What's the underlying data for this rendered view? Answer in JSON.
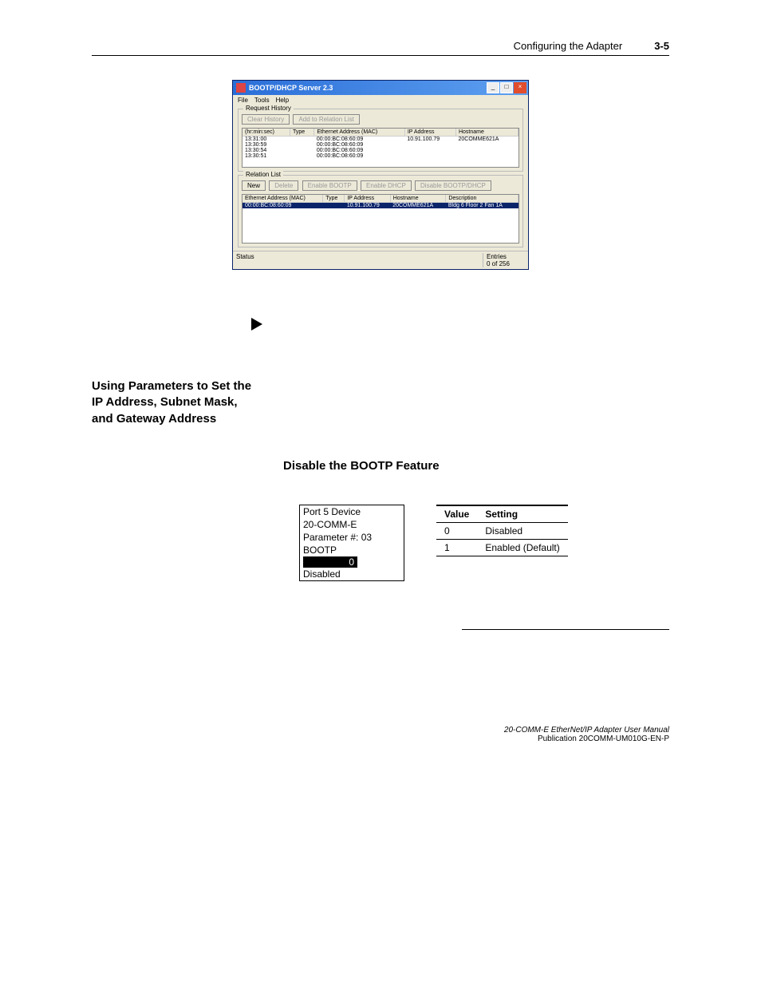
{
  "header": {
    "title": "Configuring the Adapter",
    "page": "3-5"
  },
  "win": {
    "title": "BOOTP/DHCP Server 2.3",
    "menu": [
      "File",
      "Tools",
      "Help"
    ],
    "request_history": {
      "label": "Request History",
      "buttons": {
        "clear": "Clear History",
        "add": "Add to Relation List"
      },
      "columns": [
        "(hr:min:sec)",
        "Type",
        "Ethernet Address (MAC)",
        "IP Address",
        "Hostname"
      ],
      "rows": [
        {
          "time": "13:31:00",
          "type": "",
          "mac": "00:00:BC:08:60:09",
          "ip": "10.91.100.79",
          "host": "20COMME621A"
        },
        {
          "time": "13:30:59",
          "type": "",
          "mac": "00:00:BC:08:60:09",
          "ip": "",
          "host": ""
        },
        {
          "time": "13:30:54",
          "type": "",
          "mac": "00:00:BC:08:60:09",
          "ip": "",
          "host": ""
        },
        {
          "time": "13:30:51",
          "type": "",
          "mac": "00:00:BC:08:60:09",
          "ip": "",
          "host": ""
        }
      ]
    },
    "relation_list": {
      "label": "Relation List",
      "buttons": {
        "new": "New",
        "delete": "Delete",
        "enable_bootp": "Enable BOOTP",
        "enable_dhcp": "Enable DHCP",
        "disable": "Disable BOOTP/DHCP"
      },
      "columns": [
        "Ethernet Address (MAC)",
        "Type",
        "IP Address",
        "Hostname",
        "Description"
      ],
      "rows": [
        {
          "mac": "00:00:BC:08:60:09",
          "type": "",
          "ip": "10.91.100.79",
          "host": "20COMME621A",
          "desc": "Bldg 6 Floor 2 Fan 1A"
        }
      ]
    },
    "status": {
      "label": "Status",
      "entries_label": "Entries",
      "entries": "0 of 256"
    }
  },
  "section_heading": "Using Parameters to Set the IP Address, Subnet Mask, and Gateway Address",
  "sub_heading": "Disable the BOOTP Feature",
  "lcd": {
    "line1": "Port 5 Device",
    "line2": "20-COMM-E",
    "line3": "Parameter #: 03",
    "line4": "BOOTP",
    "value": "0",
    "line6": "Disabled"
  },
  "table": {
    "head": {
      "value": "Value",
      "setting": "Setting"
    },
    "rows": [
      {
        "value": "0",
        "setting": "Disabled"
      },
      {
        "value": "1",
        "setting": "Enabled (Default)"
      }
    ]
  },
  "footer": {
    "line1": "20-COMM-E EtherNet/IP Adapter User Manual",
    "line2": "Publication 20COMM-UM010G-EN-P"
  }
}
